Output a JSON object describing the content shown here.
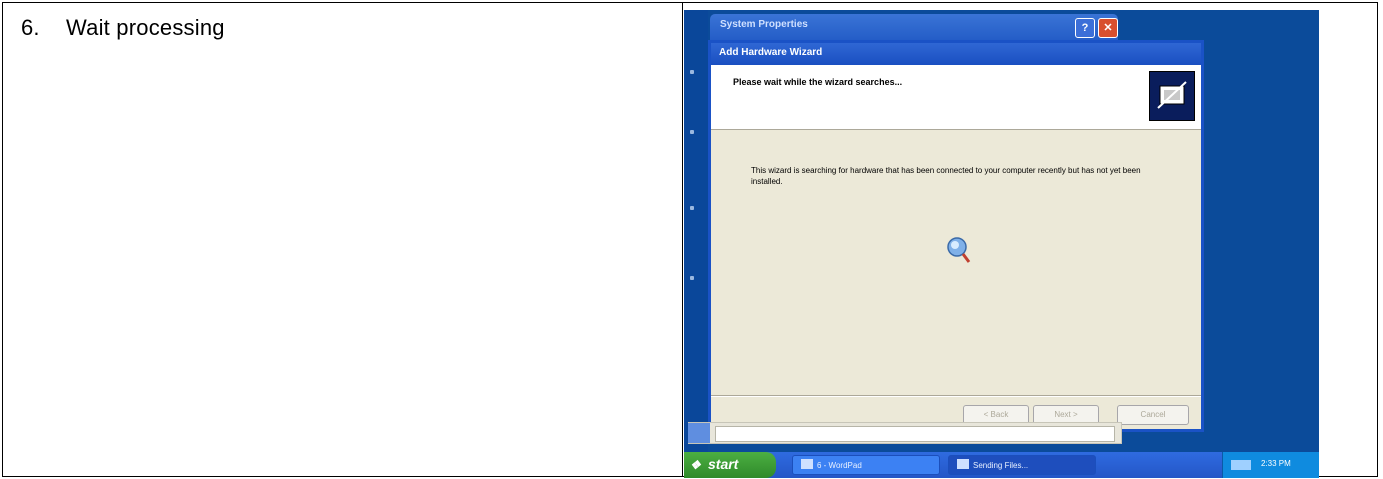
{
  "step": {
    "number": "6.",
    "text": "Wait processing"
  },
  "screenshot": {
    "system_properties_title": "System Properties",
    "title_buttons": {
      "help": "?",
      "close": "✕"
    },
    "wizard": {
      "title": "Add Hardware Wizard",
      "heading": "Please wait while the wizard searches...",
      "body": "This wizard is searching for hardware that has been connected to your computer recently but has not yet been installed.",
      "buttons": {
        "back": "< Back",
        "next": "Next >",
        "cancel": "Cancel"
      }
    },
    "taskbar": {
      "start_label": "start",
      "tasks": [
        "6 - WordPad",
        "Sending Files..."
      ],
      "clock": "2:33 PM"
    },
    "colors": {
      "desktop": "#0b4b9a",
      "titlebar": "#245dc7",
      "dialog": "#ece9d8",
      "start": "#2f8a2a"
    }
  }
}
